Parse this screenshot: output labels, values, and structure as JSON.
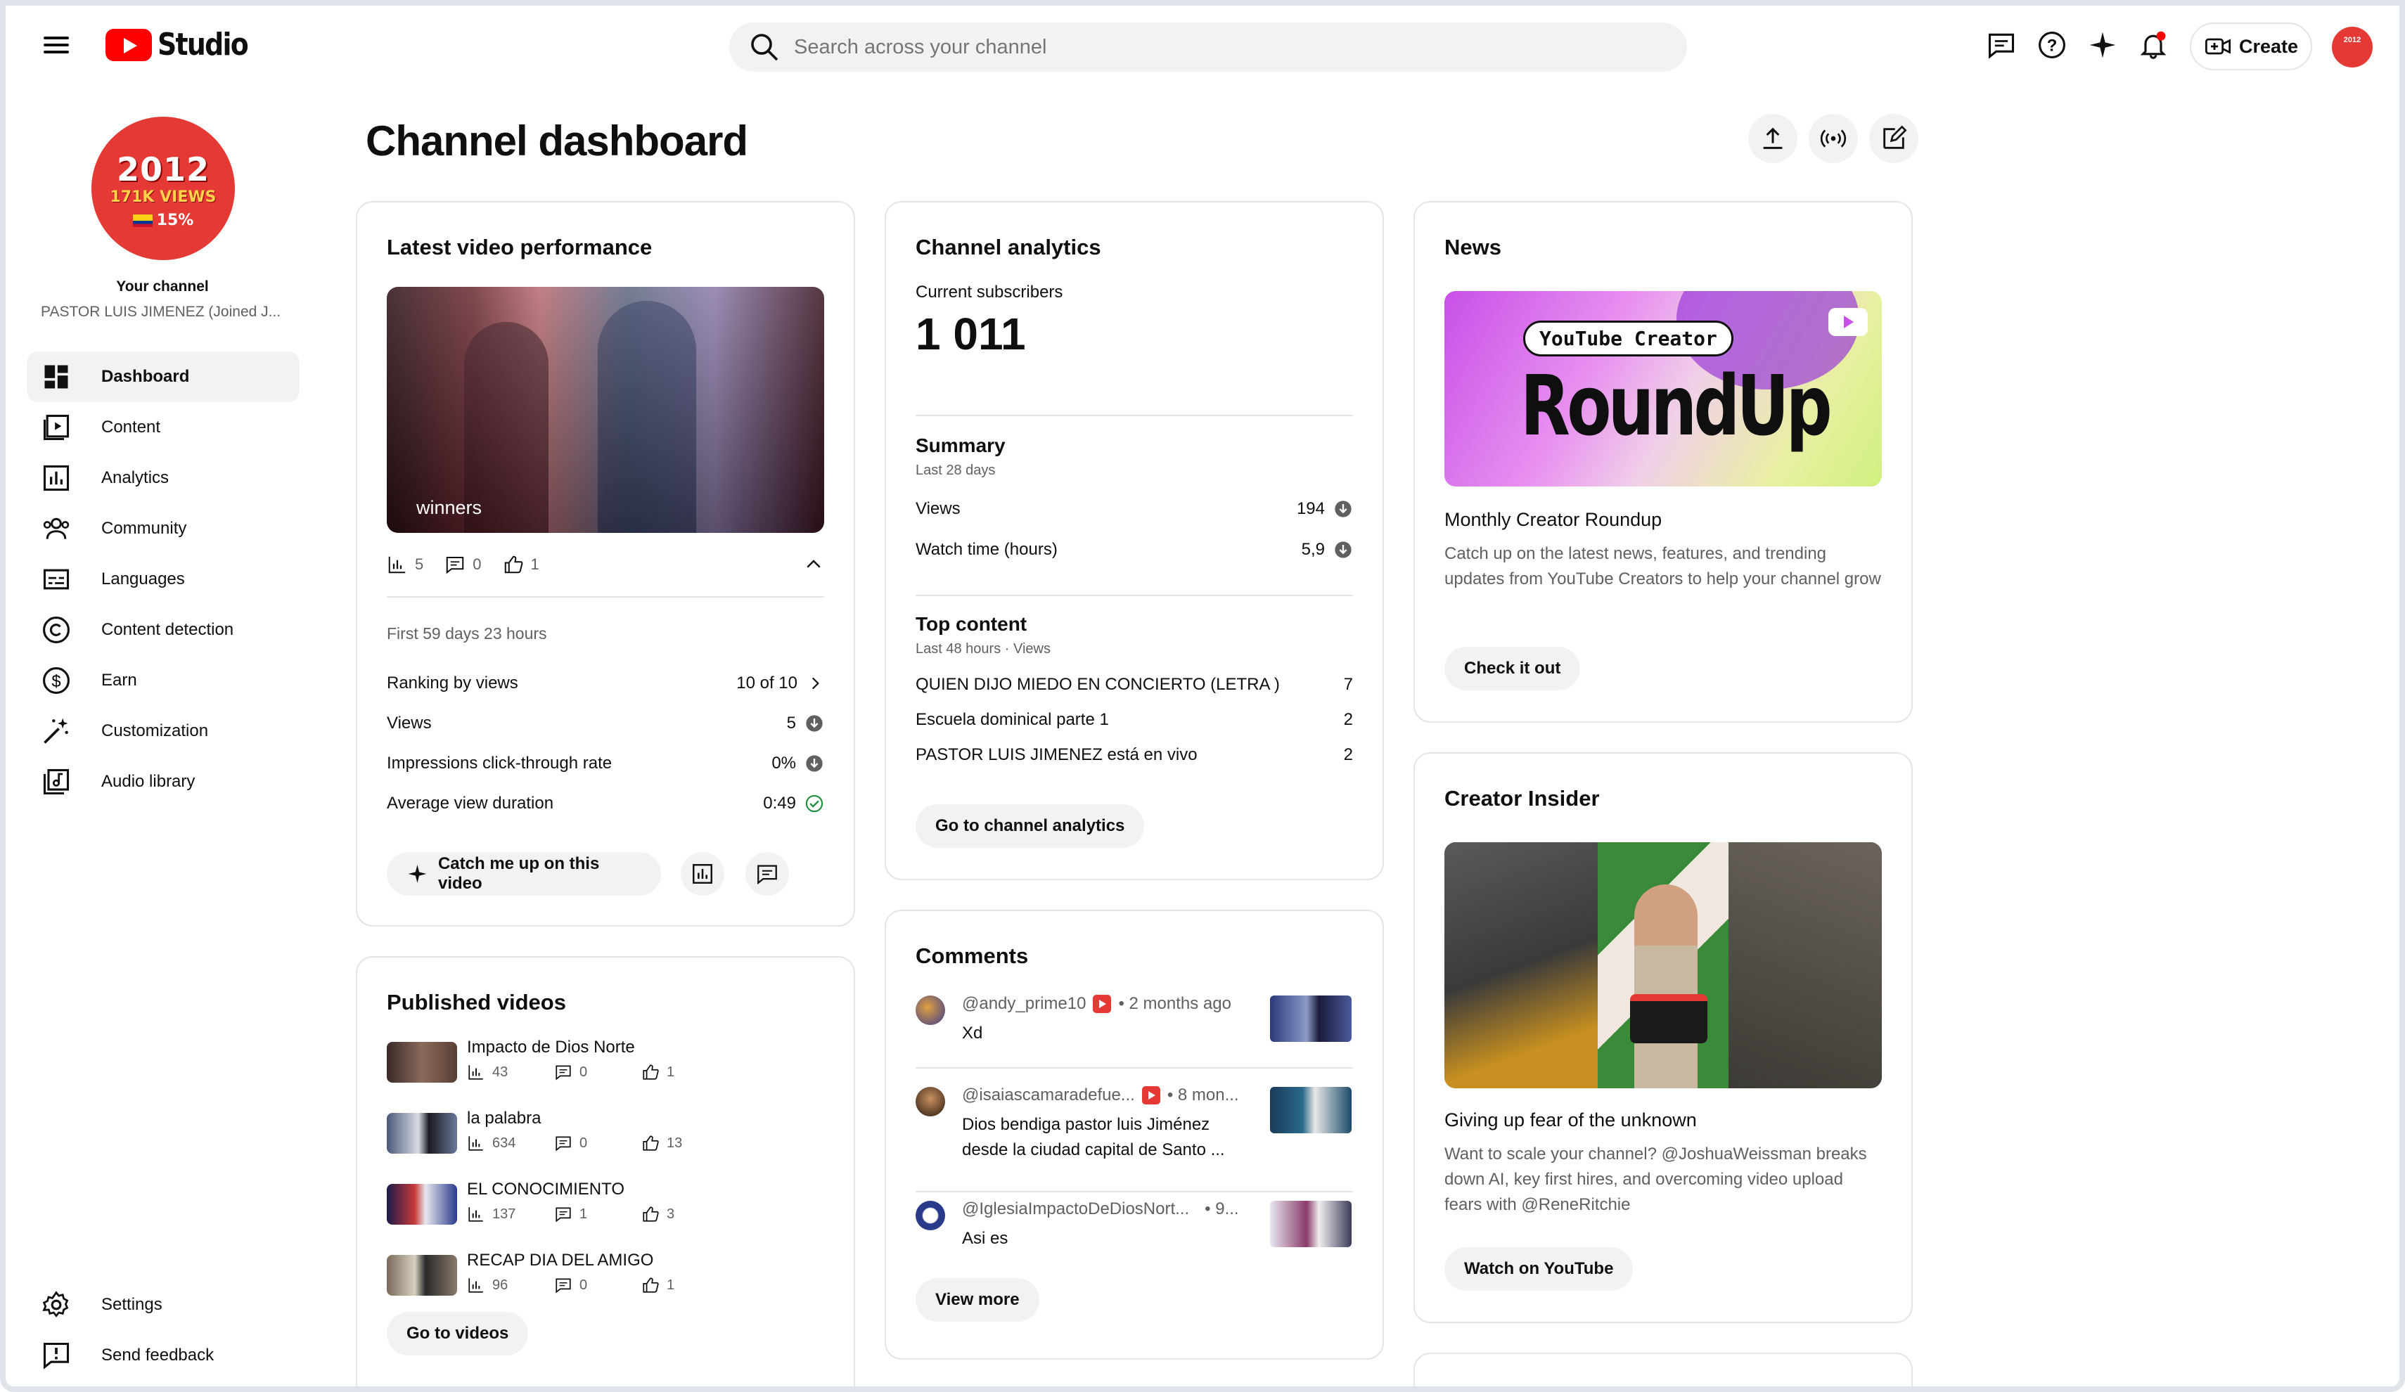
{
  "app": {
    "name": "Studio"
  },
  "search": {
    "placeholder": "Search across your channel"
  },
  "topbar": {
    "create_label": "Create",
    "avatar_text": "2012"
  },
  "sidebar": {
    "avatar": {
      "year": "2012",
      "views": "171K VIEWS",
      "percent": "15%"
    },
    "your_channel": "Your channel",
    "channel_name": "PASTOR LUIS JIMENEZ (Joined J...",
    "items": [
      {
        "label": "Dashboard",
        "icon": "dashboard-icon"
      },
      {
        "label": "Content",
        "icon": "content-icon"
      },
      {
        "label": "Analytics",
        "icon": "analytics-icon"
      },
      {
        "label": "Community",
        "icon": "community-icon"
      },
      {
        "label": "Languages",
        "icon": "languages-icon"
      },
      {
        "label": "Content detection",
        "icon": "copyright-icon"
      },
      {
        "label": "Earn",
        "icon": "dollar-icon"
      },
      {
        "label": "Customization",
        "icon": "magic-wand-icon"
      },
      {
        "label": "Audio library",
        "icon": "audio-library-icon"
      }
    ],
    "bottom": [
      {
        "label": "Settings",
        "icon": "gear-icon"
      },
      {
        "label": "Send feedback",
        "icon": "feedback-icon"
      }
    ]
  },
  "page": {
    "title": "Channel dashboard"
  },
  "latest": {
    "title": "Latest video performance",
    "video_title": "winners",
    "stats": {
      "views": "5",
      "comments": "0",
      "likes": "1"
    },
    "period": "First 59 days 23 hours",
    "rows": [
      {
        "label": "Ranking by views",
        "value": "10 of 10"
      },
      {
        "label": "Views",
        "value": "5"
      },
      {
        "label": "Impressions click-through rate",
        "value": "0%"
      },
      {
        "label": "Average view duration",
        "value": "0:49"
      }
    ],
    "catch_up": "Catch me up on this video"
  },
  "published": {
    "title": "Published videos",
    "videos": [
      {
        "title": "Impacto de Dios Norte",
        "views": "43",
        "comments": "0",
        "likes": "1"
      },
      {
        "title": "la palabra",
        "views": "634",
        "comments": "0",
        "likes": "13"
      },
      {
        "title": "EL CONOCIMIENTO",
        "views": "137",
        "comments": "1",
        "likes": "3"
      },
      {
        "title": "RECAP DIA DEL AMIGO",
        "views": "96",
        "comments": "0",
        "likes": "1"
      }
    ],
    "button": "Go to videos"
  },
  "analytics": {
    "title": "Channel analytics",
    "subs_label": "Current subscribers",
    "subs_value": "1 011",
    "summary_title": "Summary",
    "summary_period": "Last 28 days",
    "summary": [
      {
        "label": "Views",
        "value": "194"
      },
      {
        "label": "Watch time (hours)",
        "value": "5,9"
      }
    ],
    "top_title": "Top content",
    "top_period": "Last 48 hours · Views",
    "top": [
      {
        "label": "QUIEN DIJO MIEDO EN CONCIERTO (LETRA )",
        "value": "7"
      },
      {
        "label": "Escuela dominical parte 1",
        "value": "2"
      },
      {
        "label": "PASTOR LUIS JIMENEZ está en vivo",
        "value": "2"
      }
    ],
    "button": "Go to channel analytics"
  },
  "comments": {
    "title": "Comments",
    "items": [
      {
        "user": "@andy_prime10",
        "time": "• 2 months ago",
        "text": "Xd"
      },
      {
        "user": "@isaiascamaradefue...",
        "time": "• 8 mon...",
        "text": "Dios bendiga pastor luis Jiménez desde la ciudad capital de Santo ..."
      },
      {
        "user": "@IglesiaImpactoDeDiosNort...",
        "time": "• 9...",
        "text": "Asi es"
      }
    ],
    "button": "View more"
  },
  "news": {
    "title": "News",
    "image_badge": "YouTube Creator",
    "image_big": "RoundUp",
    "headline": "Monthly Creator Roundup",
    "body": "Catch up on the latest news, features, and trending updates from YouTube Creators to help your channel grow",
    "button": "Check it out"
  },
  "insider": {
    "title": "Creator Insider",
    "headline": "Giving up fear of the unknown",
    "body": "Want to scale your channel? @JoshuaWeissman breaks down AI, key first hires, and overcoming video upload fears with @ReneRitchie",
    "button": "Watch on YouTube"
  },
  "colors": {
    "accent": "#ff0000",
    "channel_red": "#e53935",
    "muted": "#606060",
    "border": "#e5e5e5"
  }
}
